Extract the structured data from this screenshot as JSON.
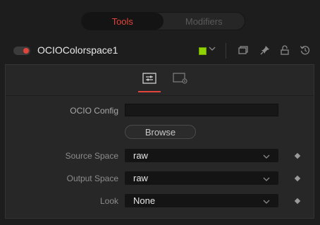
{
  "top_tabs": [
    {
      "label": "Tools",
      "active": true
    },
    {
      "label": "Modifiers",
      "active": false
    }
  ],
  "node": {
    "name": "OCIOColorspace1",
    "enabled": true,
    "color_chip": "#8fd400"
  },
  "header_icons": [
    "versions-icon",
    "pin-icon",
    "lock-icon",
    "reset-icon"
  ],
  "panel_tabs": [
    {
      "icon": "controls-icon",
      "active": true
    },
    {
      "icon": "settings-icon",
      "active": false
    }
  ],
  "controls": {
    "config": {
      "label": "OCIO Config",
      "value": ""
    },
    "browse_label": "Browse",
    "source": {
      "label": "Source Space",
      "value": "raw"
    },
    "output": {
      "label": "Output Space",
      "value": "raw"
    },
    "look": {
      "label": "Look",
      "value": "None"
    }
  },
  "colors": {
    "accent": "#e0443a",
    "chip": "#8fd400"
  }
}
